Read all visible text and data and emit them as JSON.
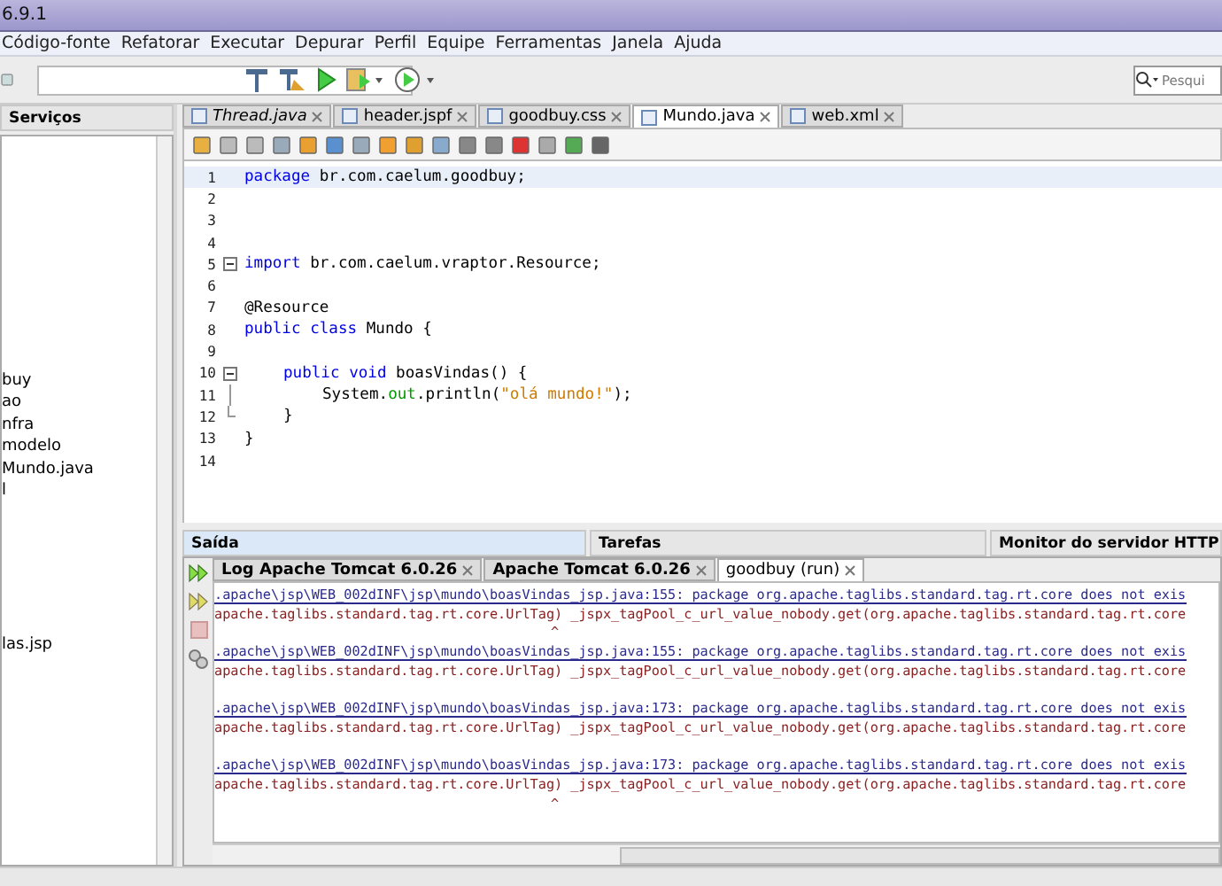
{
  "window": {
    "title": "6.9.1"
  },
  "menu": [
    "Código-fonte",
    "Refatorar",
    "Executar",
    "Depurar",
    "Perfil",
    "Equipe",
    "Ferramentas",
    "Janela",
    "Ajuda"
  ],
  "search": {
    "placeholder": "Pesqui"
  },
  "side_panel": {
    "title": "Serviços",
    "groups": [
      {
        "items": [
          "buy",
          "ao",
          "nfra",
          "modelo",
          "Mundo.java",
          "l"
        ]
      },
      {
        "items": [
          "las.jsp"
        ]
      }
    ]
  },
  "editor_tabs": [
    {
      "label": "Thread.java",
      "selected": false,
      "italic": true
    },
    {
      "label": "header.jspf",
      "selected": false,
      "italic": false
    },
    {
      "label": "goodbuy.css",
      "selected": false,
      "italic": false
    },
    {
      "label": "Mundo.java",
      "selected": true,
      "italic": false
    },
    {
      "label": "web.xml",
      "selected": false,
      "italic": false
    }
  ],
  "code": [
    {
      "number": "1",
      "current": true,
      "kind": "plain",
      "tokens": [
        {
          "kind": "keyword",
          "text": "package"
        },
        {
          "kind": "plain",
          "text": " br.com.caelum.goodbuy;"
        }
      ]
    },
    {
      "number": "2",
      "current": false,
      "kind": "plain"
    },
    {
      "number": "3",
      "current": false,
      "kind": "plain"
    },
    {
      "number": "4",
      "current": false,
      "kind": "plain"
    },
    {
      "number": "5",
      "current": false,
      "kind": "fold_start",
      "tokens": [
        {
          "kind": "keyword",
          "text": "import"
        },
        {
          "kind": "plain",
          "text": " br.com.caelum.vraptor.Resource;"
        }
      ]
    },
    {
      "number": "6",
      "current": false,
      "kind": "plain"
    },
    {
      "number": "7",
      "current": false,
      "kind": "plain",
      "tokens": [
        {
          "kind": "plain",
          "text": "@Resource"
        }
      ]
    },
    {
      "number": "8",
      "current": false,
      "kind": "plain",
      "tokens": [
        {
          "kind": "keyword",
          "text": "public class"
        },
        {
          "kind": "plain",
          "text": " Mundo {"
        }
      ],
      "children": [
        {
          "number": "9",
          "current": false,
          "kind": "plain"
        },
        {
          "number": "10",
          "current": false,
          "kind": "fold_start",
          "tokens": [
            {
              "kind": "keyword",
              "text": "public void"
            },
            {
              "kind": "plain",
              "text": " boasVindas() {"
            }
          ],
          "children": [
            {
              "number": "11",
              "current": false,
              "kind": "fold_body",
              "tokens": [
                {
                  "kind": "plain",
                  "text": "System."
                },
                {
                  "kind": "field",
                  "text": "out"
                },
                {
                  "kind": "plain",
                  "text": ".println("
                },
                {
                  "kind": "string",
                  "text": "\"olá mundo!\""
                },
                {
                  "kind": "plain",
                  "text": ");"
                }
              ]
            }
          ]
        },
        {
          "number": "12",
          "current": false,
          "kind": "fold_end",
          "tokens": [
            {
              "kind": "plain",
              "text": "}"
            }
          ]
        }
      ]
    },
    {
      "number": "13",
      "current": false,
      "kind": "plain",
      "tokens": [
        {
          "kind": "plain",
          "text": "}"
        }
      ]
    },
    {
      "number": "14",
      "current": false,
      "kind": "plain"
    }
  ],
  "bottom_panels": [
    {
      "label": "Saída",
      "selected": true
    },
    {
      "label": "Tarefas",
      "selected": false
    },
    {
      "label": "Monitor do servidor HTTP",
      "selected": false
    }
  ],
  "output_tabs": [
    {
      "label": "Log Apache Tomcat 6.0.26",
      "selected": false
    },
    {
      "label": "Apache Tomcat 6.0.26",
      "selected": false
    },
    {
      "label": "goodbuy (run)",
      "selected": true
    }
  ],
  "output_lines": [
    {
      "kind": "link",
      "text": ".apache\\jsp\\WEB_002dINF\\jsp\\mundo\\boasVindas_jsp.java:155: package org.apache.taglibs.standard.tag.rt.core does not exis"
    },
    {
      "kind": "error",
      "text": "apache.taglibs.standard.tag.rt.core.UrlTag) _jspx_tagPool_c_url_value_nobody.get(org.apache.taglibs.standard.tag.rt.core"
    },
    {
      "kind": "caret",
      "text": "^"
    },
    {
      "kind": "link",
      "text": ".apache\\jsp\\WEB_002dINF\\jsp\\mundo\\boasVindas_jsp.java:155: package org.apache.taglibs.standard.tag.rt.core does not exis"
    },
    {
      "kind": "error",
      "text": "apache.taglibs.standard.tag.rt.core.UrlTag) _jspx_tagPool_c_url_value_nobody.get(org.apache.taglibs.standard.tag.rt.core"
    },
    {
      "kind": "blank"
    },
    {
      "kind": "link",
      "text": ".apache\\jsp\\WEB_002dINF\\jsp\\mundo\\boasVindas_jsp.java:173: package org.apache.taglibs.standard.tag.rt.core does not exis"
    },
    {
      "kind": "error",
      "text": "apache.taglibs.standard.tag.rt.core.UrlTag) _jspx_tagPool_c_url_value_nobody.get(org.apache.taglibs.standard.tag.rt.core"
    },
    {
      "kind": "blank"
    },
    {
      "kind": "link",
      "text": ".apache\\jsp\\WEB_002dINF\\jsp\\mundo\\boasVindas_jsp.java:173: package org.apache.taglibs.standard.tag.rt.core does not exis"
    },
    {
      "kind": "error",
      "text": "apache.taglibs.standard.tag.rt.core.UrlTag) _jspx_tagPool_c_url_value_nobody.get(org.apache.taglibs.standard.tag.rt.core"
    },
    {
      "kind": "caret",
      "text": "^"
    }
  ]
}
